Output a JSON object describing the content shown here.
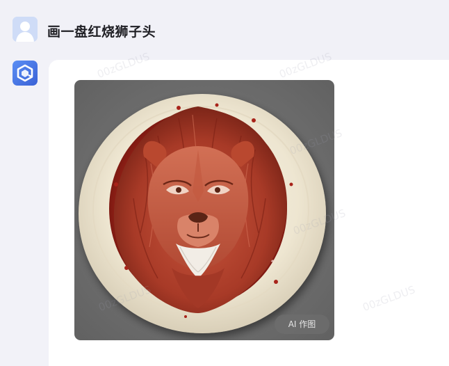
{
  "user": {
    "message": "画一盘红烧狮子头"
  },
  "assistant": {
    "image_badge": "AI 作图"
  },
  "watermark": {
    "text": "00zGLDUS"
  },
  "colors": {
    "page_background": "#f2f2f8",
    "bubble_background": "#ffffff",
    "user_avatar_bg": "#cfdcf7",
    "assistant_avatar_bg": "#4a78e6",
    "image_background": "#6e6e6e",
    "plate": "#efe8d6",
    "lion_main": "#b8432f",
    "sauce": "#a8231a"
  },
  "icons": {
    "user_avatar": "user-silhouette-icon",
    "assistant_avatar": "cube-logo-icon"
  }
}
